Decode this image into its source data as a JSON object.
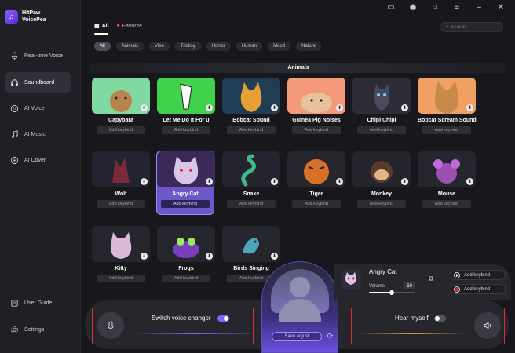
{
  "app": {
    "name": "HitPaw VoicePea"
  },
  "sidebar": {
    "items": [
      {
        "label": "Real-time Voice",
        "icon": "mic-icon",
        "active": false
      },
      {
        "label": "Soundboard",
        "icon": "headphones-icon",
        "active": true
      },
      {
        "label": "AI Voice",
        "icon": "ai-voice-icon",
        "active": false
      },
      {
        "label": "AI Music",
        "icon": "music-note-icon",
        "active": false
      },
      {
        "label": "AI Cover",
        "icon": "disc-icon",
        "active": false
      }
    ],
    "bottom": [
      {
        "label": "User Guide",
        "icon": "book-icon"
      },
      {
        "label": "Settings",
        "icon": "gear-icon"
      }
    ]
  },
  "topbar": {
    "icons": [
      "guide-book-icon",
      "discord-icon",
      "user-icon",
      "menu-icon",
      "minimize-icon",
      "close-icon"
    ]
  },
  "tabs": {
    "all": "All",
    "favorite": "Favorite"
  },
  "search": {
    "placeholder": "Search"
  },
  "chips": [
    "All",
    "Animals",
    "Vibe",
    "Tricksy",
    "Horror",
    "Human",
    "Mood",
    "Nature"
  ],
  "section_title": "Animals",
  "keybind_label": "Add keybind",
  "cards": [
    {
      "name": "Capybara",
      "bg": "#7fd9a0"
    },
    {
      "name": "Let Me Do It For u",
      "bg": "#3fd24a"
    },
    {
      "name": "Bobcat Sound",
      "bg": "#1f3d55"
    },
    {
      "name": "Guinea Pig Noises",
      "bg": "#f49a7a"
    },
    {
      "name": "Chipi Chipi",
      "bg": "#2c2c36"
    },
    {
      "name": "Bobcat Scream Sound",
      "bg": "#f0a060"
    },
    {
      "name": "Wolf",
      "bg": "#242430"
    },
    {
      "name": "Angry Cat",
      "bg": "#3a2a5a",
      "selected": true
    },
    {
      "name": "Snake",
      "bg": "#24242e"
    },
    {
      "name": "Tiger",
      "bg": "#26262e"
    },
    {
      "name": "Monkey",
      "bg": "#24242c"
    },
    {
      "name": "Mouse",
      "bg": "#26262e"
    },
    {
      "name": "Kitty",
      "bg": "#25252e"
    },
    {
      "name": "Frogs",
      "bg": "#26262f"
    },
    {
      "name": "Birds Singing",
      "bg": "#26262e"
    }
  ],
  "bottom_panel": {
    "switch_label": "Switch voice changer",
    "switch_on": true,
    "hear_label": "Hear myself",
    "hear_on": false,
    "save_adjust": "Save adjust"
  },
  "now_playing": {
    "name": "Angry Cat",
    "volume_label": "Volume",
    "volume": 50,
    "keybind1": "Add keybind",
    "keybind2": "Add keybind"
  },
  "colors": {
    "accent": "#7d63ff",
    "highlight_border": "#e3262f"
  }
}
